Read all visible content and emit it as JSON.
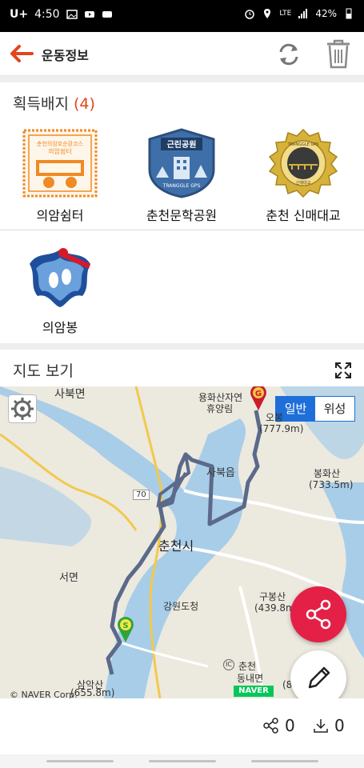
{
  "status_bar": {
    "carrier": "U+",
    "time": "4:50",
    "network": "LTE",
    "battery": "42%"
  },
  "app_bar": {
    "title": "운동정보"
  },
  "badges_section": {
    "title": "획득배지",
    "count": "(4)",
    "badges": [
      {
        "label": "의암쉼터",
        "seal_top": "춘천의암호순환코스",
        "seal_name": "의암쉼터",
        "color": "#f08a24"
      },
      {
        "label": "춘천문학공원",
        "seal_name": "근린공원",
        "seal_bottom": "TRANGGLE GPS",
        "color": "#3e6fa8"
      },
      {
        "label": "춘천 신매대교",
        "seal_top": "TRANGGLE GPS",
        "seal_bottom": "신매대교",
        "color": "#d6b23a"
      },
      {
        "label": "의암봉",
        "color": "#1f4f9c"
      }
    ]
  },
  "map_section": {
    "title": "지도 보기",
    "map_type": {
      "normal": "일반",
      "satellite": "위성"
    },
    "labels": [
      {
        "text": "사북면"
      },
      {
        "text": "용화산자연"
      },
      {
        "text": "휴양림"
      },
      {
        "text": "오봉"
      },
      {
        "text": "(777.9m)"
      },
      {
        "text": "사북읍"
      },
      {
        "text": "봉화산"
      },
      {
        "text": "(733.5m)"
      },
      {
        "text": "70"
      },
      {
        "text": "춘천시"
      },
      {
        "text": "서면"
      },
      {
        "text": "강원도청"
      },
      {
        "text": "구봉산"
      },
      {
        "text": "(439.8m)"
      },
      {
        "text": "삼악산"
      },
      {
        "text": "(655.8m)"
      },
      {
        "text": "춘천"
      },
      {
        "text": "동내면"
      },
      {
        "text": "(8"
      },
      {
        "text": "IC"
      }
    ],
    "logo": "NAVER",
    "copyright": "© NAVER Corp.",
    "start_marker": "S",
    "goal_marker": "G"
  },
  "bottom_stats": {
    "shares": "0",
    "downloads": "0"
  },
  "colors": {
    "accent": "#e1451c",
    "share_fab": "#e42046",
    "map_type_active": "#1e6fd9",
    "route": "#5b6a8a"
  }
}
